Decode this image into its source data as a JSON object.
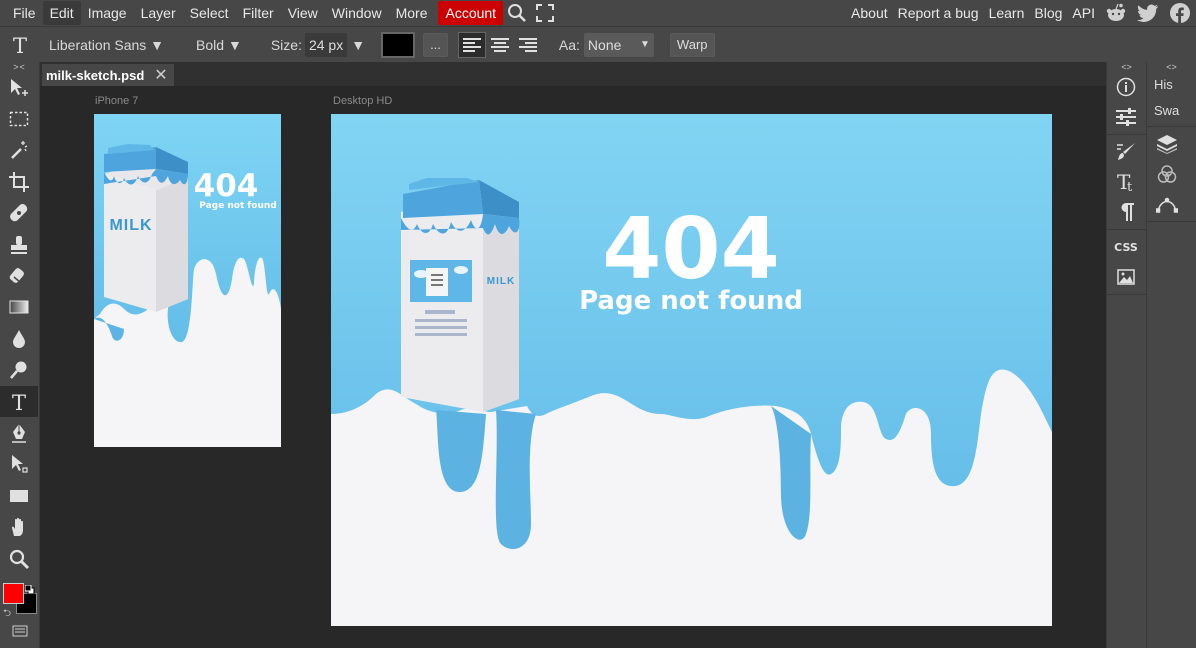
{
  "menubar": {
    "items": [
      "File",
      "Edit",
      "Image",
      "Layer",
      "Select",
      "Filter",
      "View",
      "Window",
      "More"
    ],
    "active": "Edit",
    "account": "Account",
    "right": [
      "About",
      "Report a bug",
      "Learn",
      "Blog",
      "API"
    ],
    "icons": [
      "search-icon",
      "fullscreen-icon",
      "reddit-icon",
      "twitter-icon",
      "facebook-icon"
    ],
    "account_color": "#cc0000"
  },
  "options": {
    "font_family": "Liberation Sans",
    "font_style": "Bold",
    "size_label": "Size:",
    "size_value": "24 px",
    "color_swatch": "#000000",
    "more_btn": "...",
    "aa_label": "Aa:",
    "aa_value": "None",
    "warp": "Warp"
  },
  "tabs": {
    "doc_name": "milk-sketch.psd"
  },
  "artboards": {
    "mobile_label": "iPhone 7",
    "desktop_label": "Desktop HD",
    "heading": "404",
    "subheading": "Page not found",
    "milk_label": "MILK",
    "sky_color": "#7ed2f2",
    "milk_blue": "#55b6e4"
  },
  "left_tools": [
    "move-tool-icon",
    "marquee-tool-icon",
    "magic-wand-icon",
    "crop-icon",
    "healing-icon",
    "stamp-icon",
    "eraser-icon",
    "gradient-icon",
    "blur-icon",
    "dodge-icon",
    "type-tool-icon",
    "pen-icon",
    "path-select-icon",
    "shape-icon",
    "hand-icon",
    "zoom-icon"
  ],
  "colors": {
    "foreground": "#ff0000",
    "background": "#000000"
  },
  "right_panel": {
    "dock_icons": [
      "info-icon",
      "adjust-icon",
      "brush-icon",
      "char-icon",
      "paragraph-icon",
      "css-icon",
      "image-icon"
    ],
    "css_label": "CSS",
    "tabs": [
      "His",
      "Swa"
    ],
    "panel_icons": [
      "layers-icon",
      "channels-icon",
      "paths-icon"
    ]
  }
}
